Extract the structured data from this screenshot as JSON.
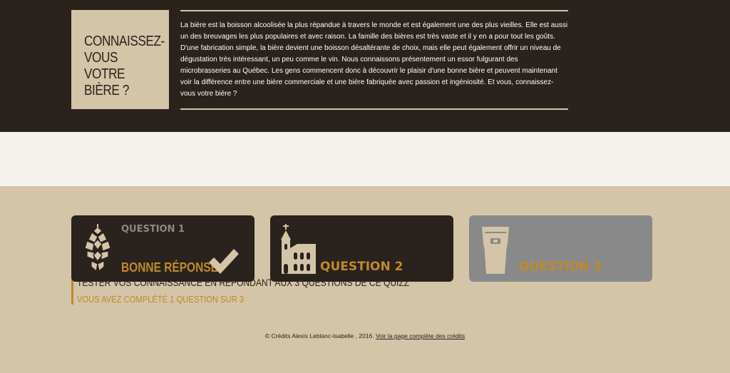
{
  "header": {
    "title": "CONNAISSEZ-VOUS VOTRE BIÈRE ?",
    "intro": "La bière est la boisson alcoolisée la plus répandue à travers le monde et est également une des plus vieilles. Elle est aussi un des breuvages les plus populaires et avec raison. La famille des bières est très vaste et il y en a pour tout les goûts. D'une fabrication simple, la bière devient une boisson désaltérante de choix, mais elle peut également offrir un niveau de dégustation très intéressant, un peu comme le vin. Nous connaissons présentement un essor fulgurant des microbrasseries au Québec. Les gens commencent donc à découvrir le plaisir d'une bonne bière et peuvent maintenant voir la différence entre une bière commerciale et une bière fabriquée avec passion et ingéniosité. Et vous, connaissez-vous votre bière ?"
  },
  "quiz_band": {
    "heading": "TESTER VOS CONNAISSANCE EN RÉPONDANT AUX 3 QUESTIONS DE CE QUIZZ",
    "progress": "VOUS AVEZ COMPLÉTÉ 1 QUESTION SUR 3"
  },
  "questions": [
    {
      "label": "QUESTION 1",
      "result": "BONNE RÉPONSE",
      "icon": "hop-icon",
      "status": "answered"
    },
    {
      "label": "QUESTION 2",
      "icon": "church-icon",
      "status": "available"
    },
    {
      "label": "QUESTION 3",
      "icon": "pint-glass-icon",
      "status": "locked"
    }
  ],
  "footer": {
    "credits": "© Crédits Alexis Leblanc-Isabelle , 2016.",
    "link": "Voir la page complète des crédits"
  },
  "colors": {
    "dark": "#2a221d",
    "tan": "#d4c4a8",
    "accent": "#c08a2a",
    "locked": "#898989"
  }
}
